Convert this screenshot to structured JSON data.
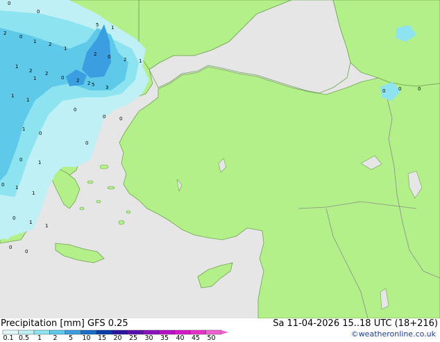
{
  "map": {
    "contour_labels": [
      "0",
      "1",
      "2",
      "5",
      "2",
      "1",
      "2",
      "1",
      "0",
      "2",
      "2",
      "1",
      "0",
      "1",
      "2",
      "0",
      "2",
      "1",
      "2",
      "5",
      "3",
      "1",
      "1",
      "0",
      "1",
      "0",
      "1",
      "0",
      "1",
      "0",
      "1",
      "1",
      "0",
      "1",
      "0",
      "0",
      "0",
      "0",
      "0",
      "0",
      "0",
      "0",
      "0"
    ],
    "colors": {
      "sea": "#e6e6e6",
      "land": "#b4f08a",
      "precip_light": "#bff0f5",
      "precip_mid": "#8de3ef",
      "precip_heavy": "#5ec9e8",
      "precip_max": "#3a9ee0",
      "border": "#8a8a8a",
      "coast": "#6fa050"
    }
  },
  "footer": {
    "title": "Precipitation [mm]  GFS 0.25",
    "valid_time": "Sa 11-04-2026 15..18 UTC (18+216)",
    "credit": "©weatheronline.co.uk",
    "colorbar_ticks": [
      "0.1",
      "0.5",
      "1",
      "2",
      "5",
      "10",
      "15",
      "20",
      "25",
      "30",
      "35",
      "40",
      "45",
      "50"
    ],
    "colorbar_colors": [
      "#e0f8fa",
      "#bff0f5",
      "#8de3ef",
      "#5ec9e8",
      "#3a9ee0",
      "#1a6ec8",
      "#0a3ca8",
      "#2a14a0",
      "#5a10b0",
      "#8a10c0",
      "#b810c8",
      "#d818c8",
      "#e830c8",
      "#f060d0"
    ]
  }
}
